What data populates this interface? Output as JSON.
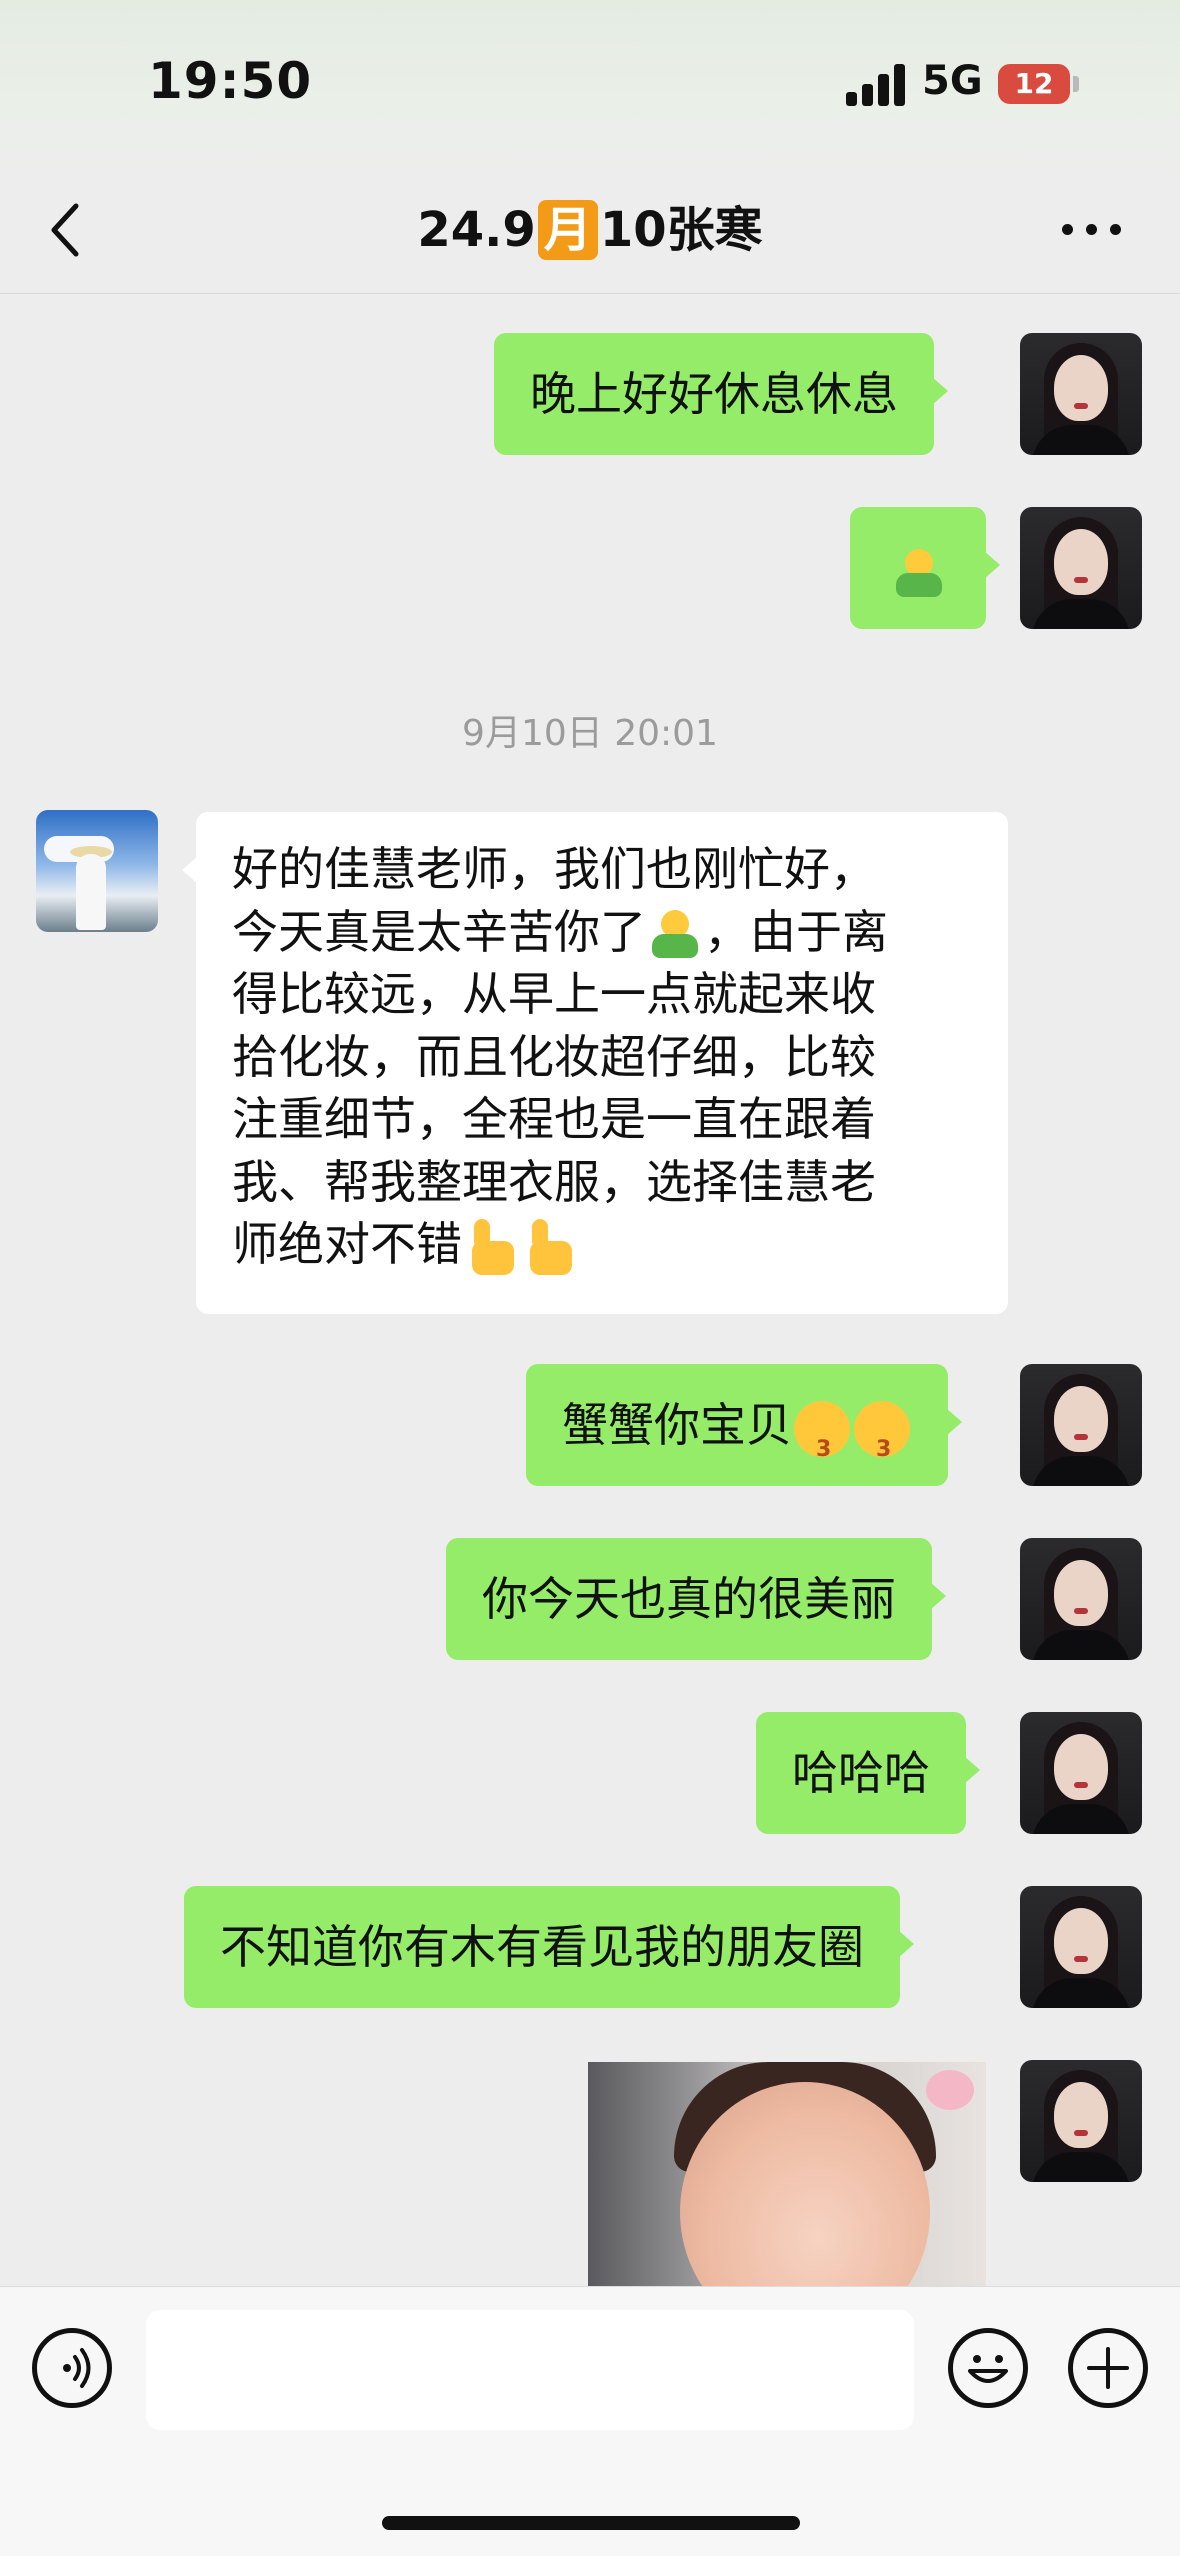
{
  "status": {
    "time": "19:50",
    "network": "5G",
    "battery": "12"
  },
  "header": {
    "title_pre": "24.9",
    "title_month": "月",
    "title_post": "10张寒"
  },
  "timestamp": "9月10日 20:01",
  "messages": [
    {
      "side": "me",
      "text": "晚上好好休息休息"
    },
    {
      "side": "me",
      "emoji": "hug-emoji"
    },
    {
      "side": "other",
      "lines": [
        "好的佳慧老师，我们也刚忙好，",
        "今天真是太辛苦你了",
        "，由于离",
        "得比较远，从早上一点就起来收",
        "拾化妆，而且化妆超仔细，比较",
        "注重细节，全程也是一直在跟着",
        "我、帮我整理衣服，选择佳慧老",
        "师绝对不错"
      ]
    },
    {
      "side": "me",
      "text": "蟹蟹你宝贝"
    },
    {
      "side": "me",
      "text": "你今天也真的很美丽"
    },
    {
      "side": "me",
      "text": "哈哈哈"
    },
    {
      "side": "me",
      "text": "不知道你有木有看见我的朋友圈"
    }
  ],
  "icons": [
    "back-icon",
    "more-icon",
    "voice-icon",
    "emoji-icon",
    "plus-icon"
  ]
}
